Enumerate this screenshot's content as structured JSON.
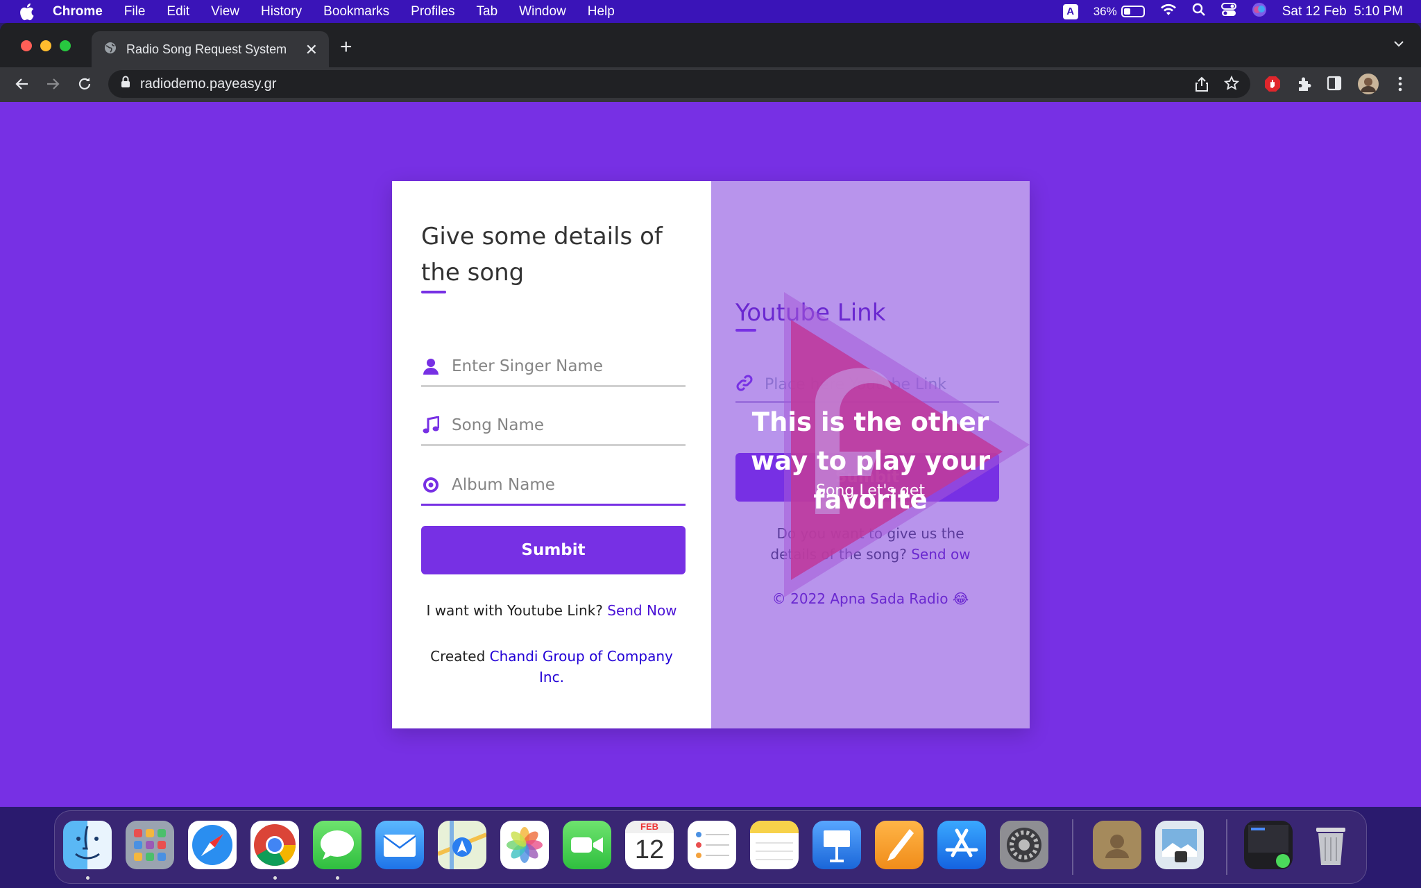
{
  "menubar": {
    "app": "Chrome",
    "items": [
      "File",
      "Edit",
      "View",
      "History",
      "Bookmarks",
      "Profiles",
      "Tab",
      "Window",
      "Help"
    ],
    "input_indicator": "A",
    "battery_percent": "36%",
    "battery_level": 0.36,
    "datetime": "Sat 12 Feb  5:10 PM"
  },
  "browser": {
    "tab_title": "Radio Song Request System",
    "url": "radiodemo.payeasy.gr"
  },
  "form": {
    "heading": "Give some details of the song",
    "singer_placeholder": "Enter Singer Name",
    "song_placeholder": "Song Name",
    "album_placeholder": "Album Name",
    "submit_label": "Sumbit",
    "youtube_prompt": "I want with Youtube Link?",
    "youtube_link": "Send Now",
    "created_prefix": "Created",
    "created_link": "Chandi Group of Company Inc."
  },
  "youtube_panel": {
    "heading": "Youtube Link",
    "link_placeholder": "Place here Youtube Link",
    "submit_label": "Sumbit",
    "question": "Do you want to give us the details of the song?",
    "question_link": "Send ow",
    "copyright": "© 2022 Apna Sada Radio 😂"
  },
  "overlay": {
    "headline": "This is the other way to play your favorite",
    "subline": "Song Let's get"
  },
  "dock": {
    "apps": [
      "Finder",
      "Launchpad",
      "Safari",
      "Google Chrome",
      "Messages",
      "Mail",
      "Maps",
      "Photos",
      "FaceTime",
      "Calendar",
      "Reminders",
      "Notes",
      "Keynote",
      "Pages",
      "App Store",
      "System Preferences",
      "Contacts",
      "Preview",
      "Screenshot",
      "Trash"
    ],
    "calendar_month": "FEB",
    "calendar_day": "12"
  },
  "colors": {
    "page_bg": "#7730e4",
    "accent": "#7730e4",
    "panel_bg": "#b894ec",
    "menubar_bg": "#3a14b8"
  }
}
